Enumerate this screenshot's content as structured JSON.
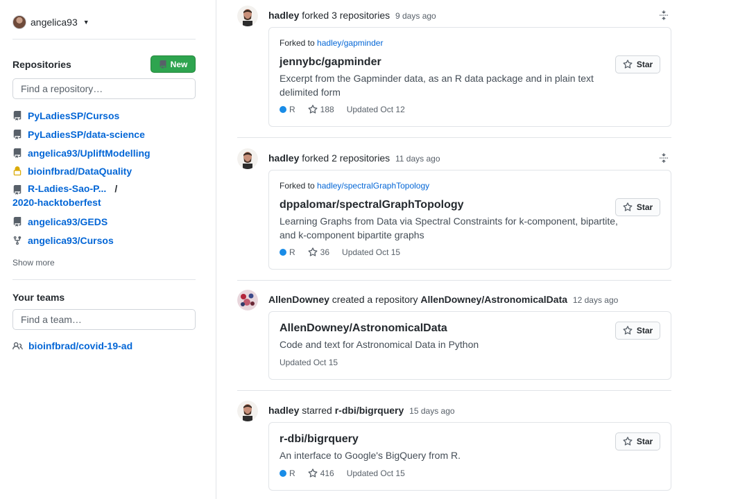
{
  "sidebar": {
    "user": {
      "name": "angelica93"
    },
    "repositories_title": "Repositories",
    "new_button": "New",
    "repo_search_placeholder": "Find a repository…",
    "repos": [
      {
        "name": "PyLadiesSP/Cursos",
        "icon": "repo-icon"
      },
      {
        "name": "PyLadiesSP/data-science",
        "icon": "repo-icon"
      },
      {
        "name": "angelica93/UpliftModelling",
        "icon": "repo-icon"
      },
      {
        "name": "bioinfbrad/DataQuality",
        "icon": "lock-icon"
      },
      {
        "name_line1": "R-Ladies-Sao-P...",
        "slash": "/",
        "name_line2": "2020-hacktoberfest",
        "icon": "repo-icon"
      },
      {
        "name": "angelica93/GEDS",
        "icon": "repo-icon"
      },
      {
        "name": "angelica93/Cursos",
        "icon": "fork-icon"
      }
    ],
    "show_more": "Show more",
    "teams_title": "Your teams",
    "team_search_placeholder": "Find a team…",
    "teams": [
      {
        "name": "bioinfbrad/covid-19-ad"
      }
    ]
  },
  "feed": [
    {
      "actor": "hadley",
      "action": "forked",
      "object": "3 repositories",
      "time": "9 days ago",
      "forked_to_label": "Forked to",
      "forked_to": "hadley/gapminder",
      "repo": "jennybc/gapminder",
      "description": "Excerpt from the Gapminder data, as an R data package and in plain text delimited form",
      "language": "R",
      "stars": "188",
      "updated": "Updated Oct 12",
      "star_button": "Star"
    },
    {
      "actor": "hadley",
      "action": "forked",
      "object": "2 repositories",
      "time": "11 days ago",
      "forked_to_label": "Forked to",
      "forked_to": "hadley/spectralGraphTopology",
      "repo": "dppalomar/spectralGraphTopology",
      "description": "Learning Graphs from Data via Spectral Constraints for k-component, bipartite, and k-component bipartite graphs",
      "language": "R",
      "stars": "36",
      "updated": "Updated Oct 15",
      "star_button": "Star"
    },
    {
      "actor": "AllenDowney",
      "action": "created a repository",
      "object": "AllenDowney/AstronomicalData",
      "time": "12 days ago",
      "repo": "AllenDowney/AstronomicalData",
      "description": "Code and text for Astronomical Data in Python",
      "updated": "Updated Oct 15",
      "star_button": "Star"
    },
    {
      "actor": "hadley",
      "action": "starred",
      "object": "r-dbi/bigrquery",
      "time": "15 days ago",
      "repo": "r-dbi/bigrquery",
      "description": "An interface to Google's BigQuery from R.",
      "language": "R",
      "stars": "416",
      "updated": "Updated Oct 15",
      "star_button": "Star"
    }
  ],
  "colors": {
    "link": "#0366d6",
    "new_button": "#2ea44f",
    "r_language": "#198ce7",
    "border": "#e1e4e8"
  }
}
